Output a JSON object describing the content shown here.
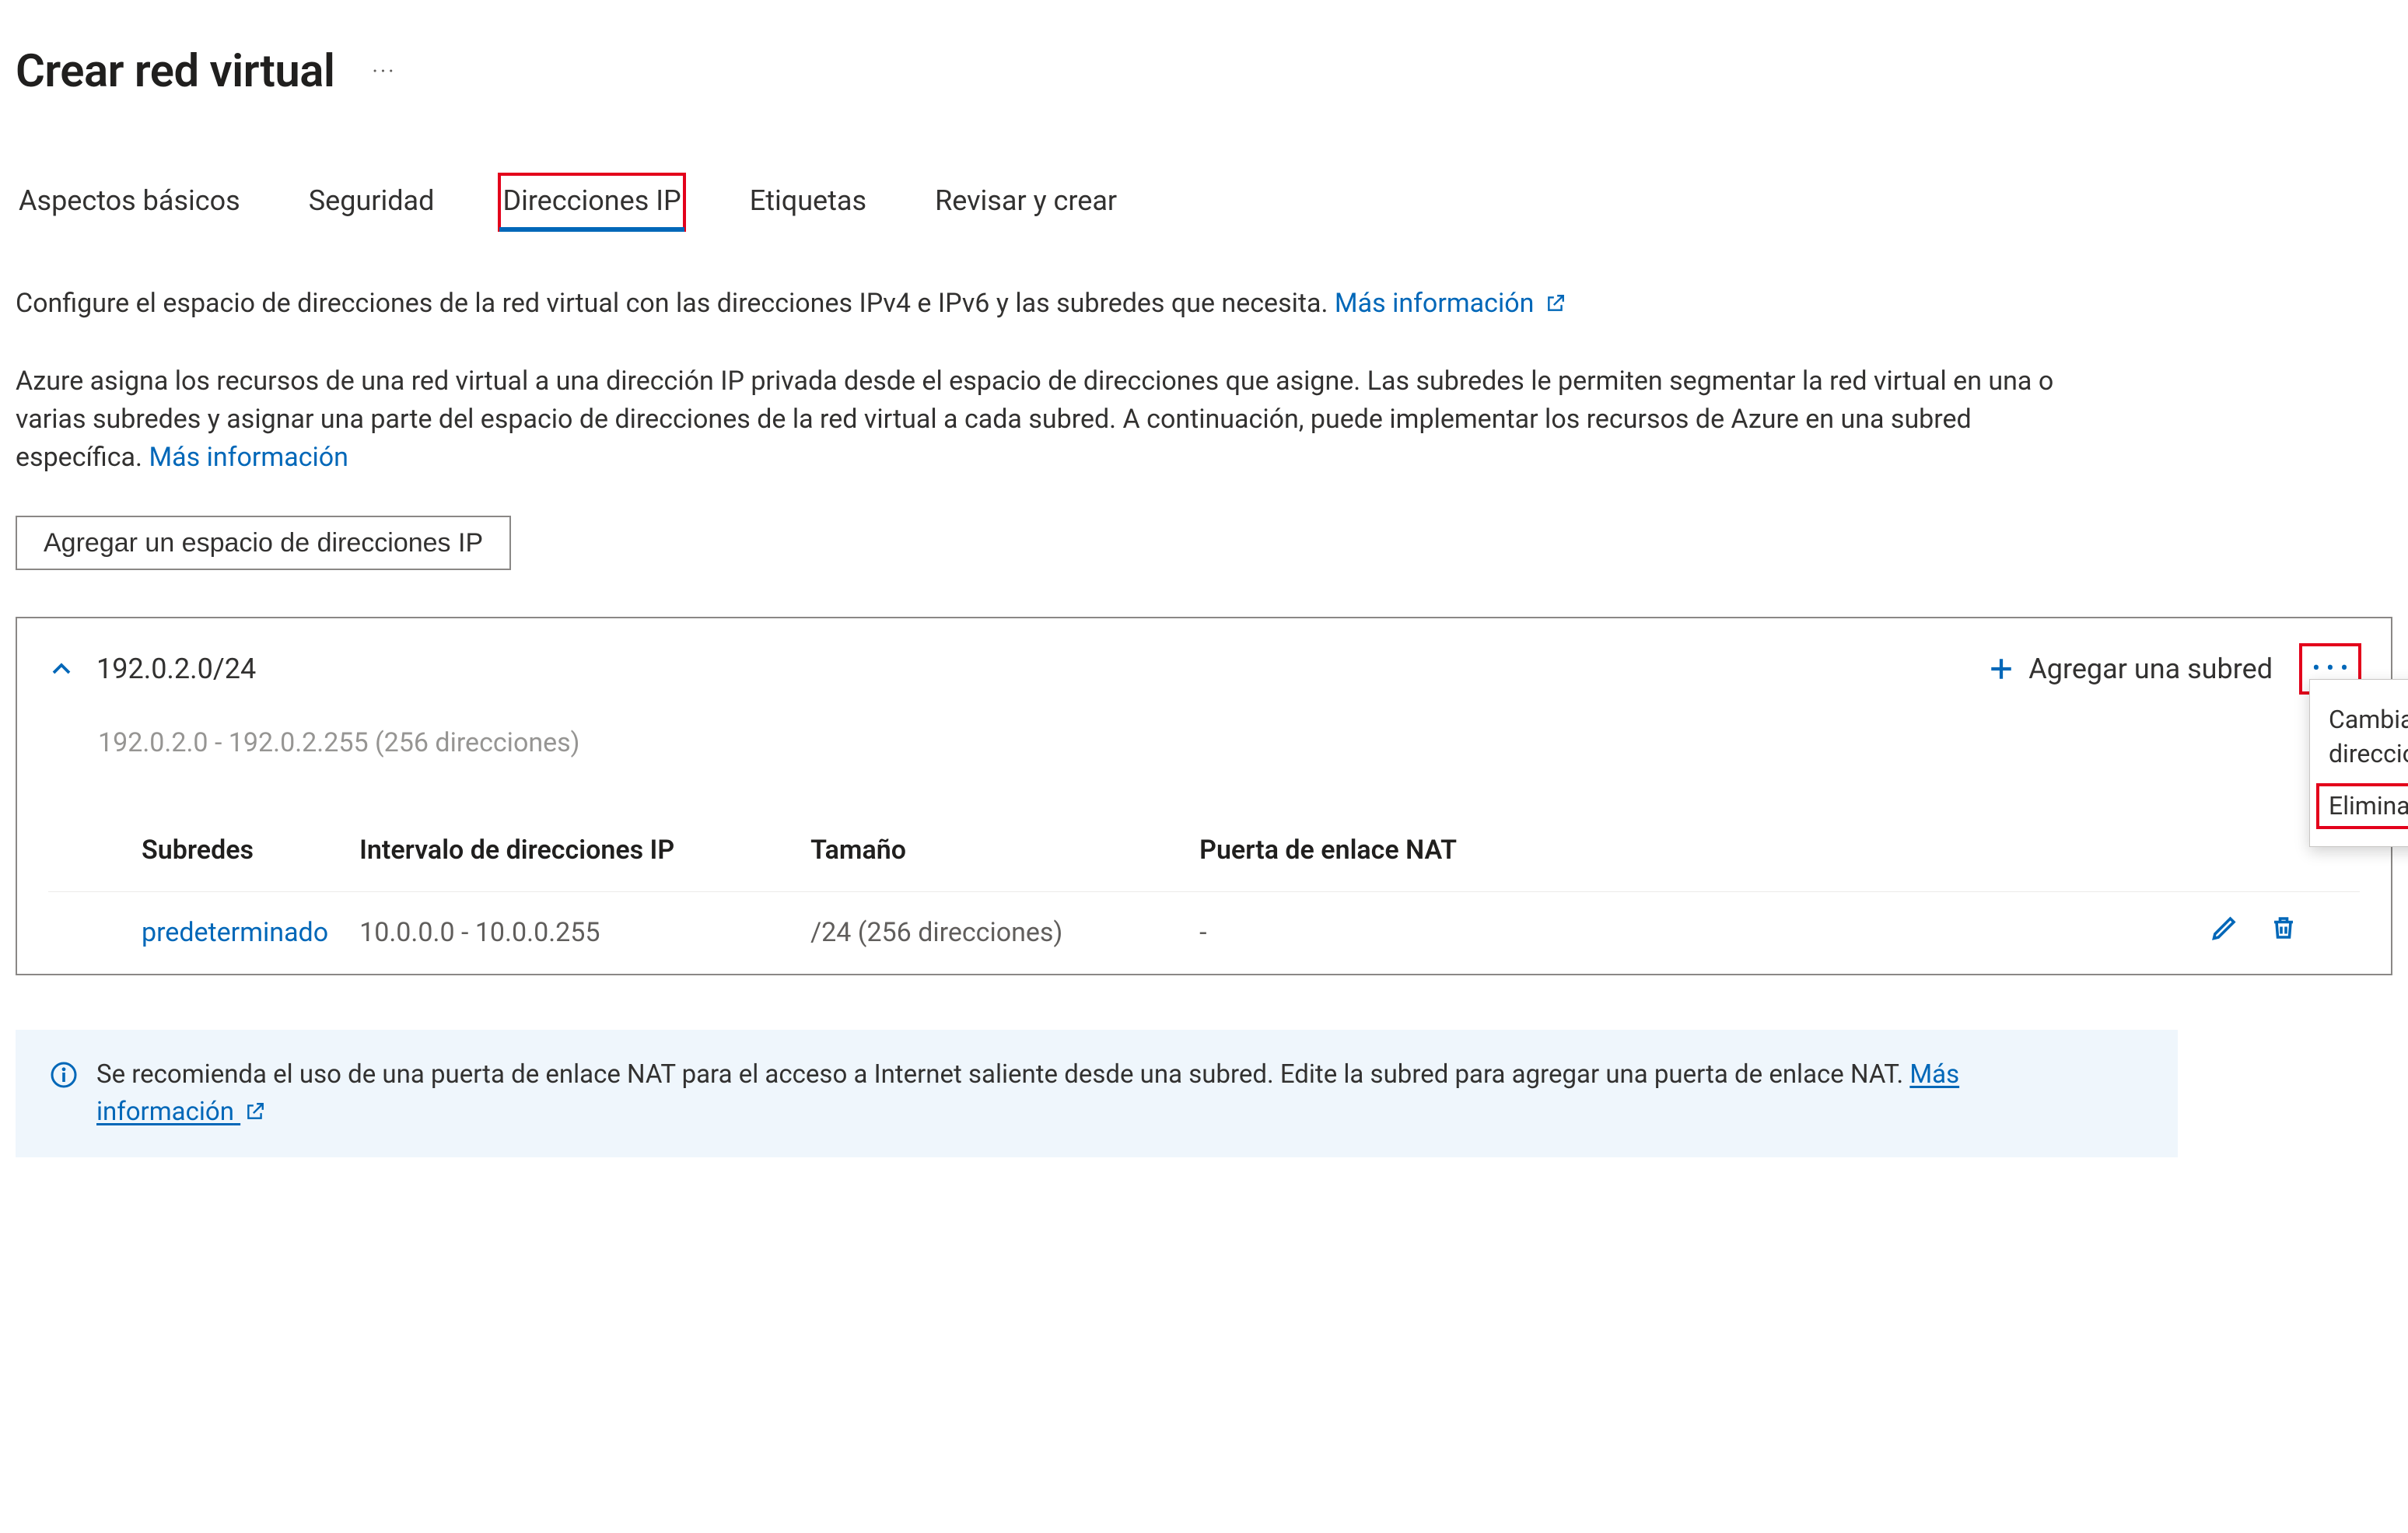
{
  "header": {
    "title": "Crear red virtual",
    "more_label": "···"
  },
  "tabs": {
    "items": [
      {
        "label": "Aspectos básicos",
        "active": false
      },
      {
        "label": "Seguridad",
        "active": false
      },
      {
        "label": "Direcciones IP",
        "active": true,
        "highlighted": true
      },
      {
        "label": "Etiquetas",
        "active": false
      },
      {
        "label": "Revisar y crear",
        "active": false
      }
    ]
  },
  "intro": {
    "line1_a": "Configure el espacio de direcciones de la red virtual con las direcciones IPv4 e IPv6 y las subredes que necesita. ",
    "line1_link": "Más información",
    "para2_a": "Azure asigna los recursos de una red virtual a una dirección IP privada desde el espacio de direcciones que asigne. Las subredes le permiten segmentar la red virtual en una o varias subredes y asignar una parte del espacio de direcciones de la red virtual a cada subred. A continuación, puede implementar los recursos de Azure en una subred específica. ",
    "para2_link": "Más información"
  },
  "buttons": {
    "add_ip_space": "Agregar un espacio de direcciones IP",
    "add_subnet": "Agregar una subred"
  },
  "address_space": {
    "cidr": "192.0.2.0/24",
    "range_note": "192.0.2.0 - 192.0.2.255 (256 direcciones)"
  },
  "context_menu": {
    "resize": "Cambiar tamaño de un espacio de direcciones",
    "delete": "Eliminar espacio de direcciones"
  },
  "table": {
    "headers": {
      "subnets": "Subredes",
      "range": "Intervalo de direcciones IP",
      "size": "Tamaño",
      "nat": "Puerta de enlace NAT"
    },
    "rows": [
      {
        "name": "predeterminado",
        "range": "10.0.0.0 - 10.0.0.255",
        "size": "/24 (256 direcciones)",
        "nat": "-"
      }
    ]
  },
  "info": {
    "text_a": "Se recomienda el uso de una puerta de enlace NAT para el acceso a Internet saliente desde una subred. Edite la subred para agregar una puerta de enlace NAT. ",
    "link": "Más información"
  }
}
